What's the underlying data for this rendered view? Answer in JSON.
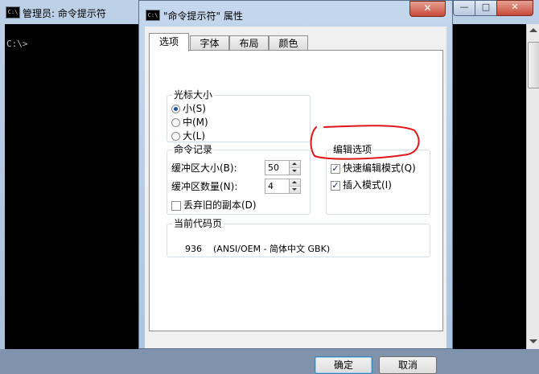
{
  "console_window": {
    "title": "管理员: 命令提示符",
    "icon_text": "C:\\",
    "prompt": "C:\\>",
    "minimize": "—",
    "maximize": "□",
    "close": "✕"
  },
  "dialog": {
    "title": "\"命令提示符\" 属性",
    "icon_text": "C:\\",
    "close": "✕",
    "tabs": [
      {
        "label": "选项"
      },
      {
        "label": "字体"
      },
      {
        "label": "布局"
      },
      {
        "label": "颜色"
      }
    ],
    "cursor_size": {
      "title": "光标大小",
      "options": [
        "小(S)",
        "中(M)",
        "大(L)"
      ],
      "selected_index": 0
    },
    "command_history": {
      "title": "命令记录",
      "buffer_size_label": "缓冲区大小(B):",
      "buffer_size_value": "50",
      "buffer_count_label": "缓冲区数量(N):",
      "buffer_count_value": "4",
      "discard_duplicates_label": "丢弃旧的副本(D)",
      "discard_duplicates_checked": false
    },
    "edit_options": {
      "title": "编辑选项",
      "quick_edit_label": "快速编辑模式(Q)",
      "quick_edit_checked": true,
      "insert_mode_label": "插入模式(I)",
      "insert_mode_checked": true
    },
    "code_page": {
      "title": "当前代码页",
      "number": "936",
      "name": "(ANSI/OEM - 简体中文 GBK)"
    },
    "ok_label": "确定",
    "cancel_label": "取消",
    "check_mark": "✓"
  },
  "colors": {
    "annotation": "#e0161b"
  }
}
